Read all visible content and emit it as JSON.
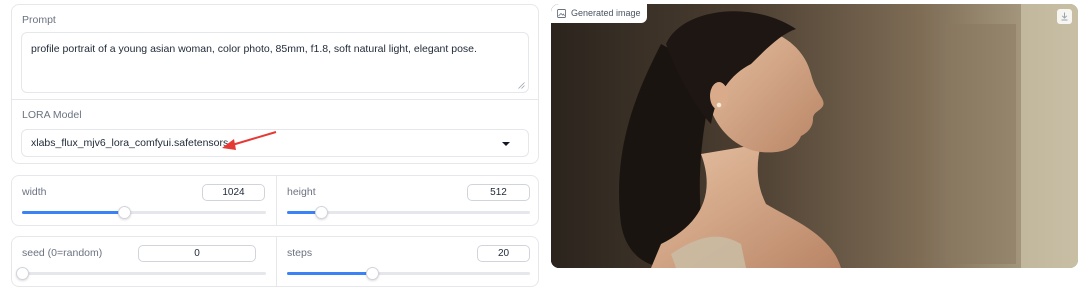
{
  "prompt": {
    "label": "Prompt",
    "value": "profile portrait of a young asian woman, color photo, 85mm, f1.8, soft natural light, elegant pose."
  },
  "lora": {
    "label": "LORA Model",
    "selected": "xlabs_flux_mjv6_lora_comfyui.safetensors"
  },
  "width": {
    "label": "width",
    "value": "1024",
    "fraction": 0.42
  },
  "height": {
    "label": "height",
    "value": "512",
    "fraction": 0.14
  },
  "seed": {
    "label": "seed (0=random)",
    "value": "0",
    "fraction": 0.0
  },
  "steps": {
    "label": "steps",
    "value": "20",
    "fraction": 0.35
  },
  "output": {
    "label": "Generated image"
  },
  "colors": {
    "accent": "#3b82f6",
    "annotation": "#e53935"
  },
  "icons": {
    "image": "image-icon",
    "download": "download-icon",
    "caret": "chevron-down-icon"
  }
}
